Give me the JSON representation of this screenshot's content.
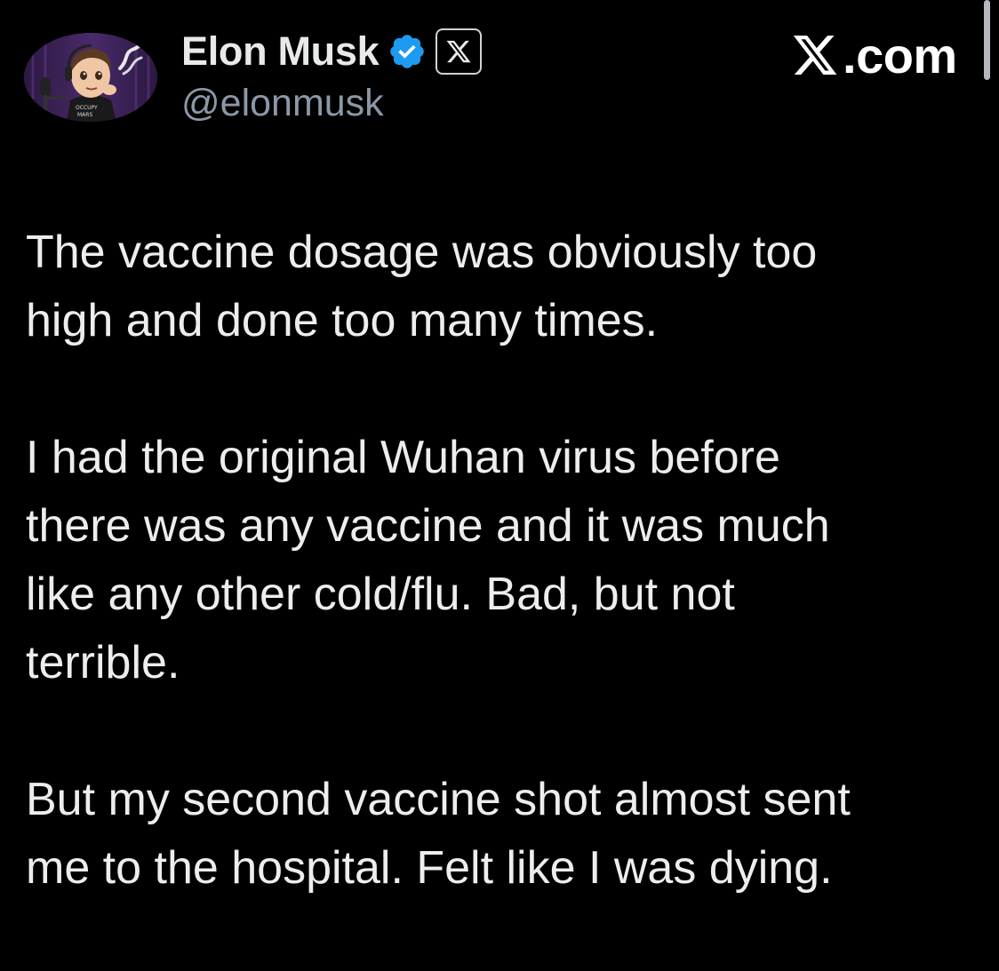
{
  "header": {
    "display_name": "Elon Musk",
    "handle": "@elonmusk",
    "verified_icon": "verified-badge-icon",
    "affiliate_icon": "x-logo-icon",
    "brand_text": "com",
    "brand_prefix": "𝕏."
  },
  "avatar": {
    "icon": "avatar-cartoon-icon",
    "shirt_text_1": "OCCUPY",
    "shirt_text_2": "MARS"
  },
  "tweet": {
    "paragraphs": [
      {
        "lines": [
          "The vaccine dosage was obviously too",
          "high and done too many times."
        ]
      },
      {
        "lines": [
          "I had the original Wuhan virus before",
          "there was any vaccine and it was much",
          "like any other cold/flu. Bad, but not",
          "terrible."
        ]
      },
      {
        "lines": [
          "But my second vaccine shot almost sent",
          "me to the hospital. Felt like I was dying."
        ]
      }
    ]
  },
  "colors": {
    "background": "#000000",
    "text": "#e7e9ea",
    "secondary_text": "#8b98a5",
    "verified_blue": "#1d9bf0"
  }
}
